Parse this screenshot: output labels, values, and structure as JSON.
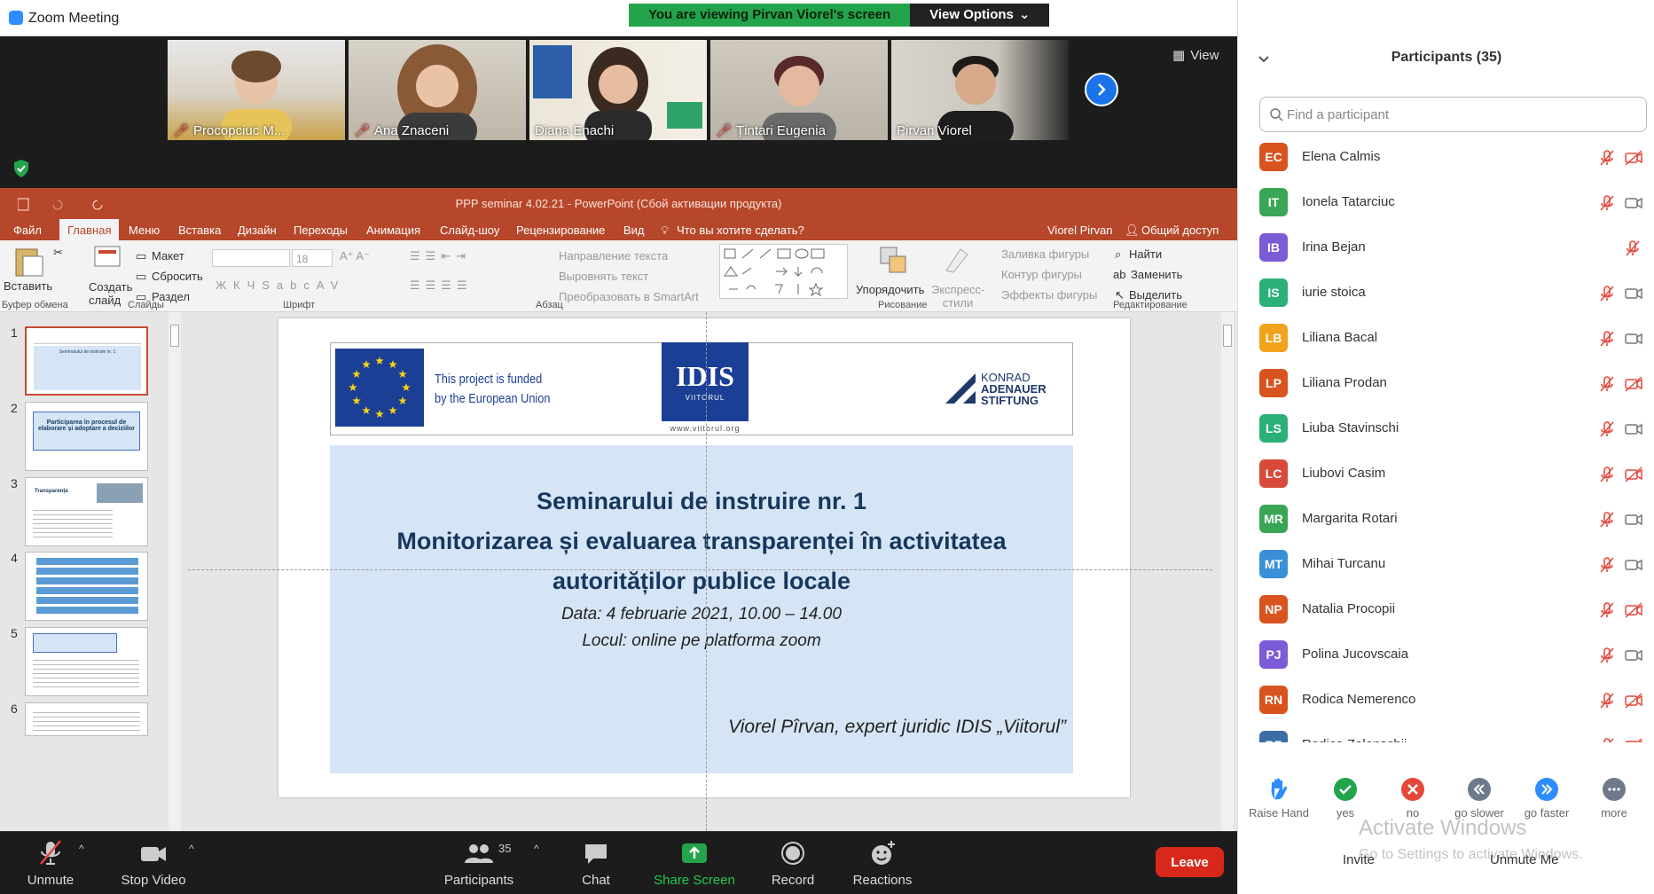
{
  "window": {
    "title": "Zoom Meeting"
  },
  "banner": {
    "viewing": "You are viewing Pirvan Viorel's screen",
    "options": "View Options"
  },
  "gallery": {
    "view_label": "View",
    "tiles": [
      {
        "name": "Procopciuc M...",
        "muted": true
      },
      {
        "name": "Ana Znaceni",
        "muted": true
      },
      {
        "name": "Diana Enachi",
        "muted": false
      },
      {
        "name": "Țintari Eugenia",
        "muted": true
      },
      {
        "name": "Pirvan Viorel",
        "muted": false
      }
    ]
  },
  "ppt": {
    "title": "PPP seminar 4.02.21 - PowerPoint (Сбой активации продукта)",
    "tabs": [
      "Файл",
      "Главная",
      "Меню",
      "Вставка",
      "Дизайн",
      "Переходы",
      "Анимация",
      "Слайд-шоу",
      "Рецензирование",
      "Вид"
    ],
    "tellme": "Что вы хотите сделать?",
    "user": "Viorel Pirvan",
    "share": "Общий доступ",
    "ribbon": {
      "paste": "Вставить",
      "create_slide": "Создать слайд",
      "layout": "Макет",
      "reset": "Сбросить",
      "section": "Раздел",
      "font_size": "18",
      "text_direction": "Направление текста",
      "align_text": "Выровнять текст",
      "smartart": "Преобразовать в SmartArt",
      "arrange": "Упорядочить",
      "quick_styles": "Экспресс-стили",
      "shape_fill": "Заливка фигуры",
      "shape_outline": "Контур фигуры",
      "shape_effects": "Эффекты фигуры",
      "find": "Найти",
      "replace": "Заменить",
      "select": "Выделить",
      "groups": [
        "Буфер обмена",
        "Слайды",
        "Шрифт",
        "Абзац",
        "Рисование",
        "Редактирование"
      ]
    },
    "thumbnails": [
      {
        "num": "1",
        "text": "Seminarului de instruire nr. 1"
      },
      {
        "num": "2",
        "text": "Participarea în procesul de elaborare și adoptare a deciziilor"
      },
      {
        "num": "3",
        "text": "Transparența"
      },
      {
        "num": "4",
        "text": ""
      },
      {
        "num": "5",
        "text": ""
      },
      {
        "num": "6",
        "text": ""
      }
    ],
    "slide": {
      "funded": [
        "This project is funded",
        "by the European Union"
      ],
      "idis": "IDIS",
      "viitorul": "VIITORUL",
      "idis_url": "www.viitorul.org",
      "konrad": [
        "KONRAD",
        "ADENAUER",
        "STIFTUNG"
      ],
      "line1": "Seminarului de instruire nr. 1",
      "line2": "Monitorizarea și evaluarea transparenței în activitatea",
      "line3": "autorităților publice locale",
      "date": "Data: 4 februarie 2021, 10.00 – 14.00",
      "place": "Locul: online pe platforma zoom",
      "author": "Viorel Pîrvan, expert juridic IDIS „Viitorul”"
    }
  },
  "participants": {
    "header": "Participants (35)",
    "search_placeholder": "Find a participant",
    "list": [
      {
        "initials": "EC",
        "name": "Elena Calmis",
        "color": "#d9531e",
        "video_off": true
      },
      {
        "initials": "IT",
        "name": "Ionela Tatarciuc",
        "color": "#3aa655",
        "video_off": false
      },
      {
        "initials": "IB",
        "name": "Irina Bejan",
        "color": "#7b5bd6",
        "video_off": null
      },
      {
        "initials": "IS",
        "name": "iurie stoica",
        "color": "#2cb07a",
        "video_off": false
      },
      {
        "initials": "LB",
        "name": "Liliana Bacal",
        "color": "#f2a31b",
        "video_off": false
      },
      {
        "initials": "LP",
        "name": "Liliana Prodan",
        "color": "#d9531e",
        "video_off": true
      },
      {
        "initials": "LS",
        "name": "Liuba Stavinschi",
        "color": "#2cb07a",
        "video_off": false
      },
      {
        "initials": "LC",
        "name": "Liubovi Casim",
        "color": "#d94a3a",
        "video_off": true
      },
      {
        "initials": "MR",
        "name": "Margarita Rotari",
        "color": "#3aa655",
        "video_off": false
      },
      {
        "initials": "MT",
        "name": "Mihai Turcanu",
        "color": "#3b8fd9",
        "video_off": false
      },
      {
        "initials": "NP",
        "name": "Natalia Procopii",
        "color": "#d9531e",
        "video_off": true
      },
      {
        "initials": "PJ",
        "name": "Polina Jucovscaia",
        "color": "#7b5bd6",
        "video_off": false
      },
      {
        "initials": "RN",
        "name": "Rodica Nemerenco",
        "color": "#d9531e",
        "video_off": true
      },
      {
        "initials": "RZ",
        "name": "Rodica Zalenschii",
        "color": "#3a6ea5",
        "video_off": true
      }
    ],
    "reactions": [
      {
        "label": "Raise Hand"
      },
      {
        "label": "yes"
      },
      {
        "label": "no"
      },
      {
        "label": "go slower"
      },
      {
        "label": "go faster"
      },
      {
        "label": "more"
      }
    ],
    "invite": "Invite",
    "unmute_me": "Unmute Me",
    "watermark1": "Activate Windows",
    "watermark2": "Go to Settings to activate Windows."
  },
  "controls": {
    "unmute": "Unmute",
    "stop_video": "Stop Video",
    "participants": "Participants",
    "participants_count": "35",
    "chat": "Chat",
    "share_screen": "Share Screen",
    "record": "Record",
    "reactions": "Reactions",
    "leave": "Leave"
  }
}
